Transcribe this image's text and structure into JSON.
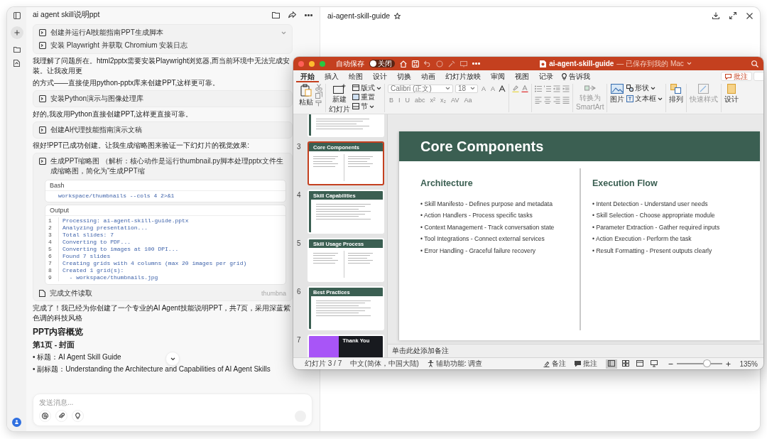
{
  "chat": {
    "title": "ai agent skill说明ppt",
    "messages": [
      {
        "kind": "steps",
        "steps": [
          "创建并运行AI技能指南PPT生成脚本",
          "安装 Playwright 并获取 Chromium 安装日志"
        ]
      },
      {
        "kind": "text",
        "lines": [
          "我理解了问题所在。html2pptx需要安装Playwright浏览器,而当前环境中无法完成安装。让我改用更",
          "的方式——直接使用python-pptx库来创建PPT,这样更可靠。"
        ]
      },
      {
        "kind": "steps",
        "steps": [
          "安装Python演示与图像处理库"
        ]
      },
      {
        "kind": "text",
        "lines": [
          "好的,我改用Python直接创建PPT,这样更直接可靠。"
        ]
      },
      {
        "kind": "steps",
        "steps": [
          "创建AI代理技能指南演示文稿"
        ]
      },
      {
        "kind": "text",
        "lines": [
          "很好!PPT已成功创建。让我生成缩略图来验证一下幻灯片的视觉效果:"
        ]
      },
      {
        "kind": "tool",
        "label": "生成PPT缩略图 （解析：核心动作是运行thumbnail.py脚本处理pptx文件生成缩略图，简化为“生成PPT缩",
        "bash_title": "Bash",
        "bash_code": "workspace/thumbnails --cols 4 2>&1",
        "output_title": "Output",
        "output_lines": [
          {
            "n": "1",
            "text": "Processing: ai-agent-skill-guide.pptx"
          },
          {
            "n": "2",
            "text": "Analyzing presentation..."
          },
          {
            "n": "3",
            "text": "Total slides: 7"
          },
          {
            "n": "4",
            "text": "Converting to PDF..."
          },
          {
            "n": "5",
            "text": "Converting to images at 100 DPI..."
          },
          {
            "n": "6",
            "text": "Found 7 slides"
          },
          {
            "n": "7",
            "text": "Creating grids with 4 columns (max 20 images per grid)"
          },
          {
            "n": "8",
            "text": "Created 1 grid(s):"
          },
          {
            "n": "9",
            "text": "  - workspace/thumbnails.jpg"
          }
        ],
        "footer_label": "完成文件读取",
        "footer_file": "thumbna"
      },
      {
        "kind": "text",
        "lines": [
          "完成了！我已经为你创建了一个专业的AI Agent技能说明PPT，共7页，采用深蓝紫色调的科技风格"
        ]
      },
      {
        "kind": "heading",
        "text": "PPT内容概览"
      },
      {
        "kind": "subheading",
        "text": "第1页 - 封面"
      },
      {
        "kind": "bullets",
        "items": [
          "• 标题：AI Agent Skill Guide",
          "• 副标题：Understanding the Architecture and Capabilities of AI Agent Skills"
        ]
      }
    ],
    "composer": {
      "placeholder": "发送消息..."
    }
  },
  "document": {
    "title": "ai-agent-skill-guide"
  },
  "powerpoint": {
    "autosave": {
      "label": "自动保存",
      "toggle_label": "关闭",
      "on": false
    },
    "title": "ai-agent-skill-guide",
    "title_note": "— 已保存到我的 Mac",
    "tabs": [
      {
        "label": "开始",
        "selected": true
      },
      {
        "label": "插入",
        "selected": false
      },
      {
        "label": "绘图",
        "selected": false
      },
      {
        "label": "设计",
        "selected": false
      },
      {
        "label": "切换",
        "selected": false
      },
      {
        "label": "动画",
        "selected": false
      },
      {
        "label": "幻灯片放映",
        "selected": false
      },
      {
        "label": "审阅",
        "selected": false
      },
      {
        "label": "视图",
        "selected": false
      },
      {
        "label": "记录",
        "selected": false
      }
    ],
    "tell_me": "告诉我",
    "comments_button": "批注",
    "ribbon": {
      "paste": "粘贴",
      "new_slide": [
        "新建",
        "幻灯片"
      ],
      "layout": "版式",
      "reset": "重置",
      "section": "节",
      "font": "Calibri (正文)",
      "size": "18",
      "size_buttons": [
        "A",
        "A"
      ],
      "format_buttons": [
        "B",
        "I",
        "U",
        "abc",
        "x²",
        "x₂",
        "AV",
        "Aa"
      ],
      "smartart": [
        "转换为",
        "SmartArt"
      ],
      "picture": "图片",
      "shape": "形状",
      "textbox": "文本框",
      "arrange": "排列",
      "quick_styles": "快速样式",
      "designer": "设计"
    },
    "slides": [
      {
        "kind": "tail",
        "selected": false
      },
      {
        "kind": "two_column",
        "number": "3",
        "title": "Core Components",
        "selected": true
      },
      {
        "kind": "list",
        "number": "4",
        "title": "Skill Capabilities",
        "selected": false
      },
      {
        "kind": "two_column",
        "number": "5",
        "title": "Skill Usage Process",
        "selected": false
      },
      {
        "kind": "list",
        "number": "6",
        "title": "Best Practices",
        "selected": false
      },
      {
        "kind": "closing",
        "number": "7",
        "title": "Thank You",
        "selected": false
      }
    ],
    "current_slide": {
      "title": "Core Components",
      "columns": [
        {
          "heading": "Architecture",
          "bullets": [
            "• Skill Manifesto - Defines purpose and metadata",
            "• Action Handlers - Process specific tasks",
            "• Context Management - Track conversation state",
            "• Tool Integrations - Connect external services",
            "• Error Handling - Graceful failure recovery"
          ]
        },
        {
          "heading": "Execution Flow",
          "bullets": [
            "• Intent Detection - Understand user needs",
            "• Skill Selection - Choose appropriate module",
            "• Parameter Extraction - Gather required inputs",
            "• Action Execution - Perform the task",
            "• Result Formatting - Present outputs clearly"
          ]
        }
      ]
    },
    "notes_placeholder": "单击此处添加备注",
    "status": {
      "slide": "幻灯片 3 / 7",
      "language": "中文(简体，中国大陆)",
      "accessibility": "辅助功能: 调查",
      "notes": "备注",
      "comments": "批注",
      "views": [
        {
          "selected": true
        },
        {
          "selected": false
        },
        {
          "selected": false
        },
        {
          "selected": false
        }
      ],
      "zoom_slider": {
        "level": 0.65
      },
      "zoom": "135%"
    }
  }
}
